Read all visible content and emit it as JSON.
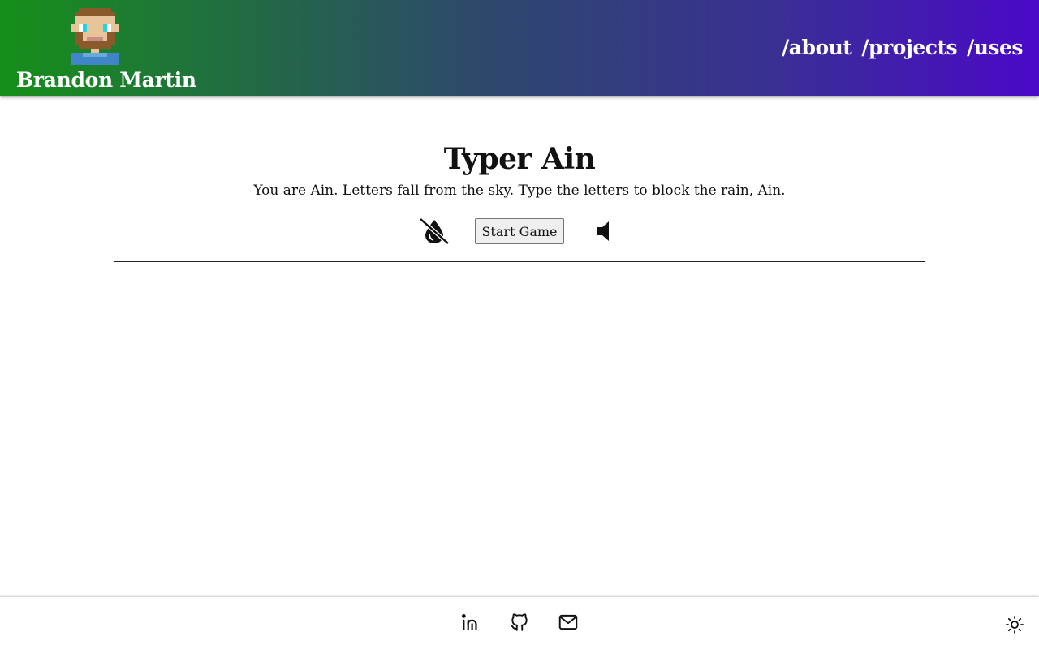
{
  "header": {
    "site_name": "Brandon Martin",
    "avatar_icon": "pixel-avatar-icon",
    "nav": [
      "/about",
      "/projects",
      "/uses"
    ]
  },
  "main": {
    "title": "Typer Ain",
    "subtitle": "You are Ain. Letters fall from the sky. Type the letters to block the rain, Ain.",
    "start_label": "Start Game",
    "rain_toggle_icon": "rain-off-icon",
    "sound_toggle_icon": "speaker-muted-icon"
  },
  "footer": {
    "links": [
      "linkedin-icon",
      "github-icon",
      "mail-icon"
    ],
    "theme_icon": "sun-icon"
  },
  "colors": {
    "header_gradient_start": "#168f1a",
    "header_gradient_end": "#4a08c8",
    "header_text": "#ffffff"
  }
}
